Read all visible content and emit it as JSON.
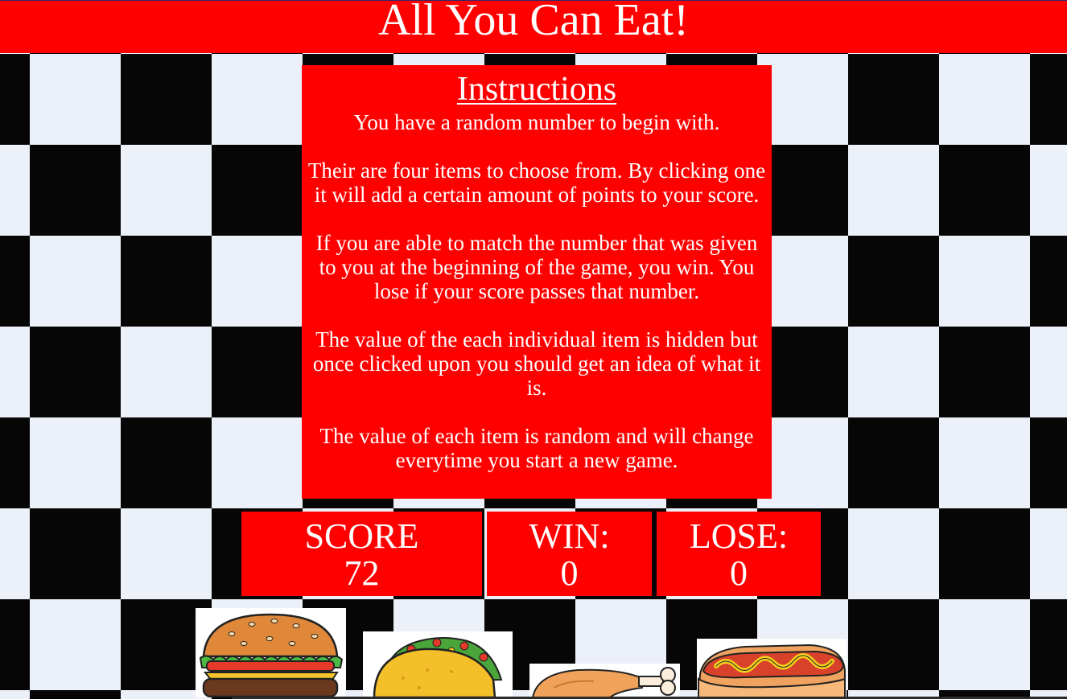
{
  "header": {
    "title": "All You Can Eat!"
  },
  "instructions": {
    "heading": "Instructions",
    "paragraphs": [
      "You have a random number to begin with.",
      "Their are four items to choose from. By clicking one it will add a certain amount of points to your score.",
      "If you are able to match the number that was given to you at the beginning of the game, you win. You lose if your score passes that number.",
      "The value of the each individual item is hidden but once clicked upon you should get an idea of what it is.",
      "The value of each item is random and will change everytime you start a new game."
    ]
  },
  "scoreboard": {
    "score_label": "SCORE",
    "score_value": "72",
    "win_label": "WIN:",
    "win_value": "0",
    "lose_label": "LOSE:",
    "lose_value": "0"
  },
  "items": [
    {
      "name": "burger-icon"
    },
    {
      "name": "taco-icon"
    },
    {
      "name": "chicken-leg-icon"
    },
    {
      "name": "hotdog-icon"
    }
  ],
  "colors": {
    "header_bg": "#ff0000",
    "panel_bg": "#ff0000",
    "text": "#ffffff",
    "checker_dark": "#060606",
    "checker_light": "#ecf0f8"
  }
}
